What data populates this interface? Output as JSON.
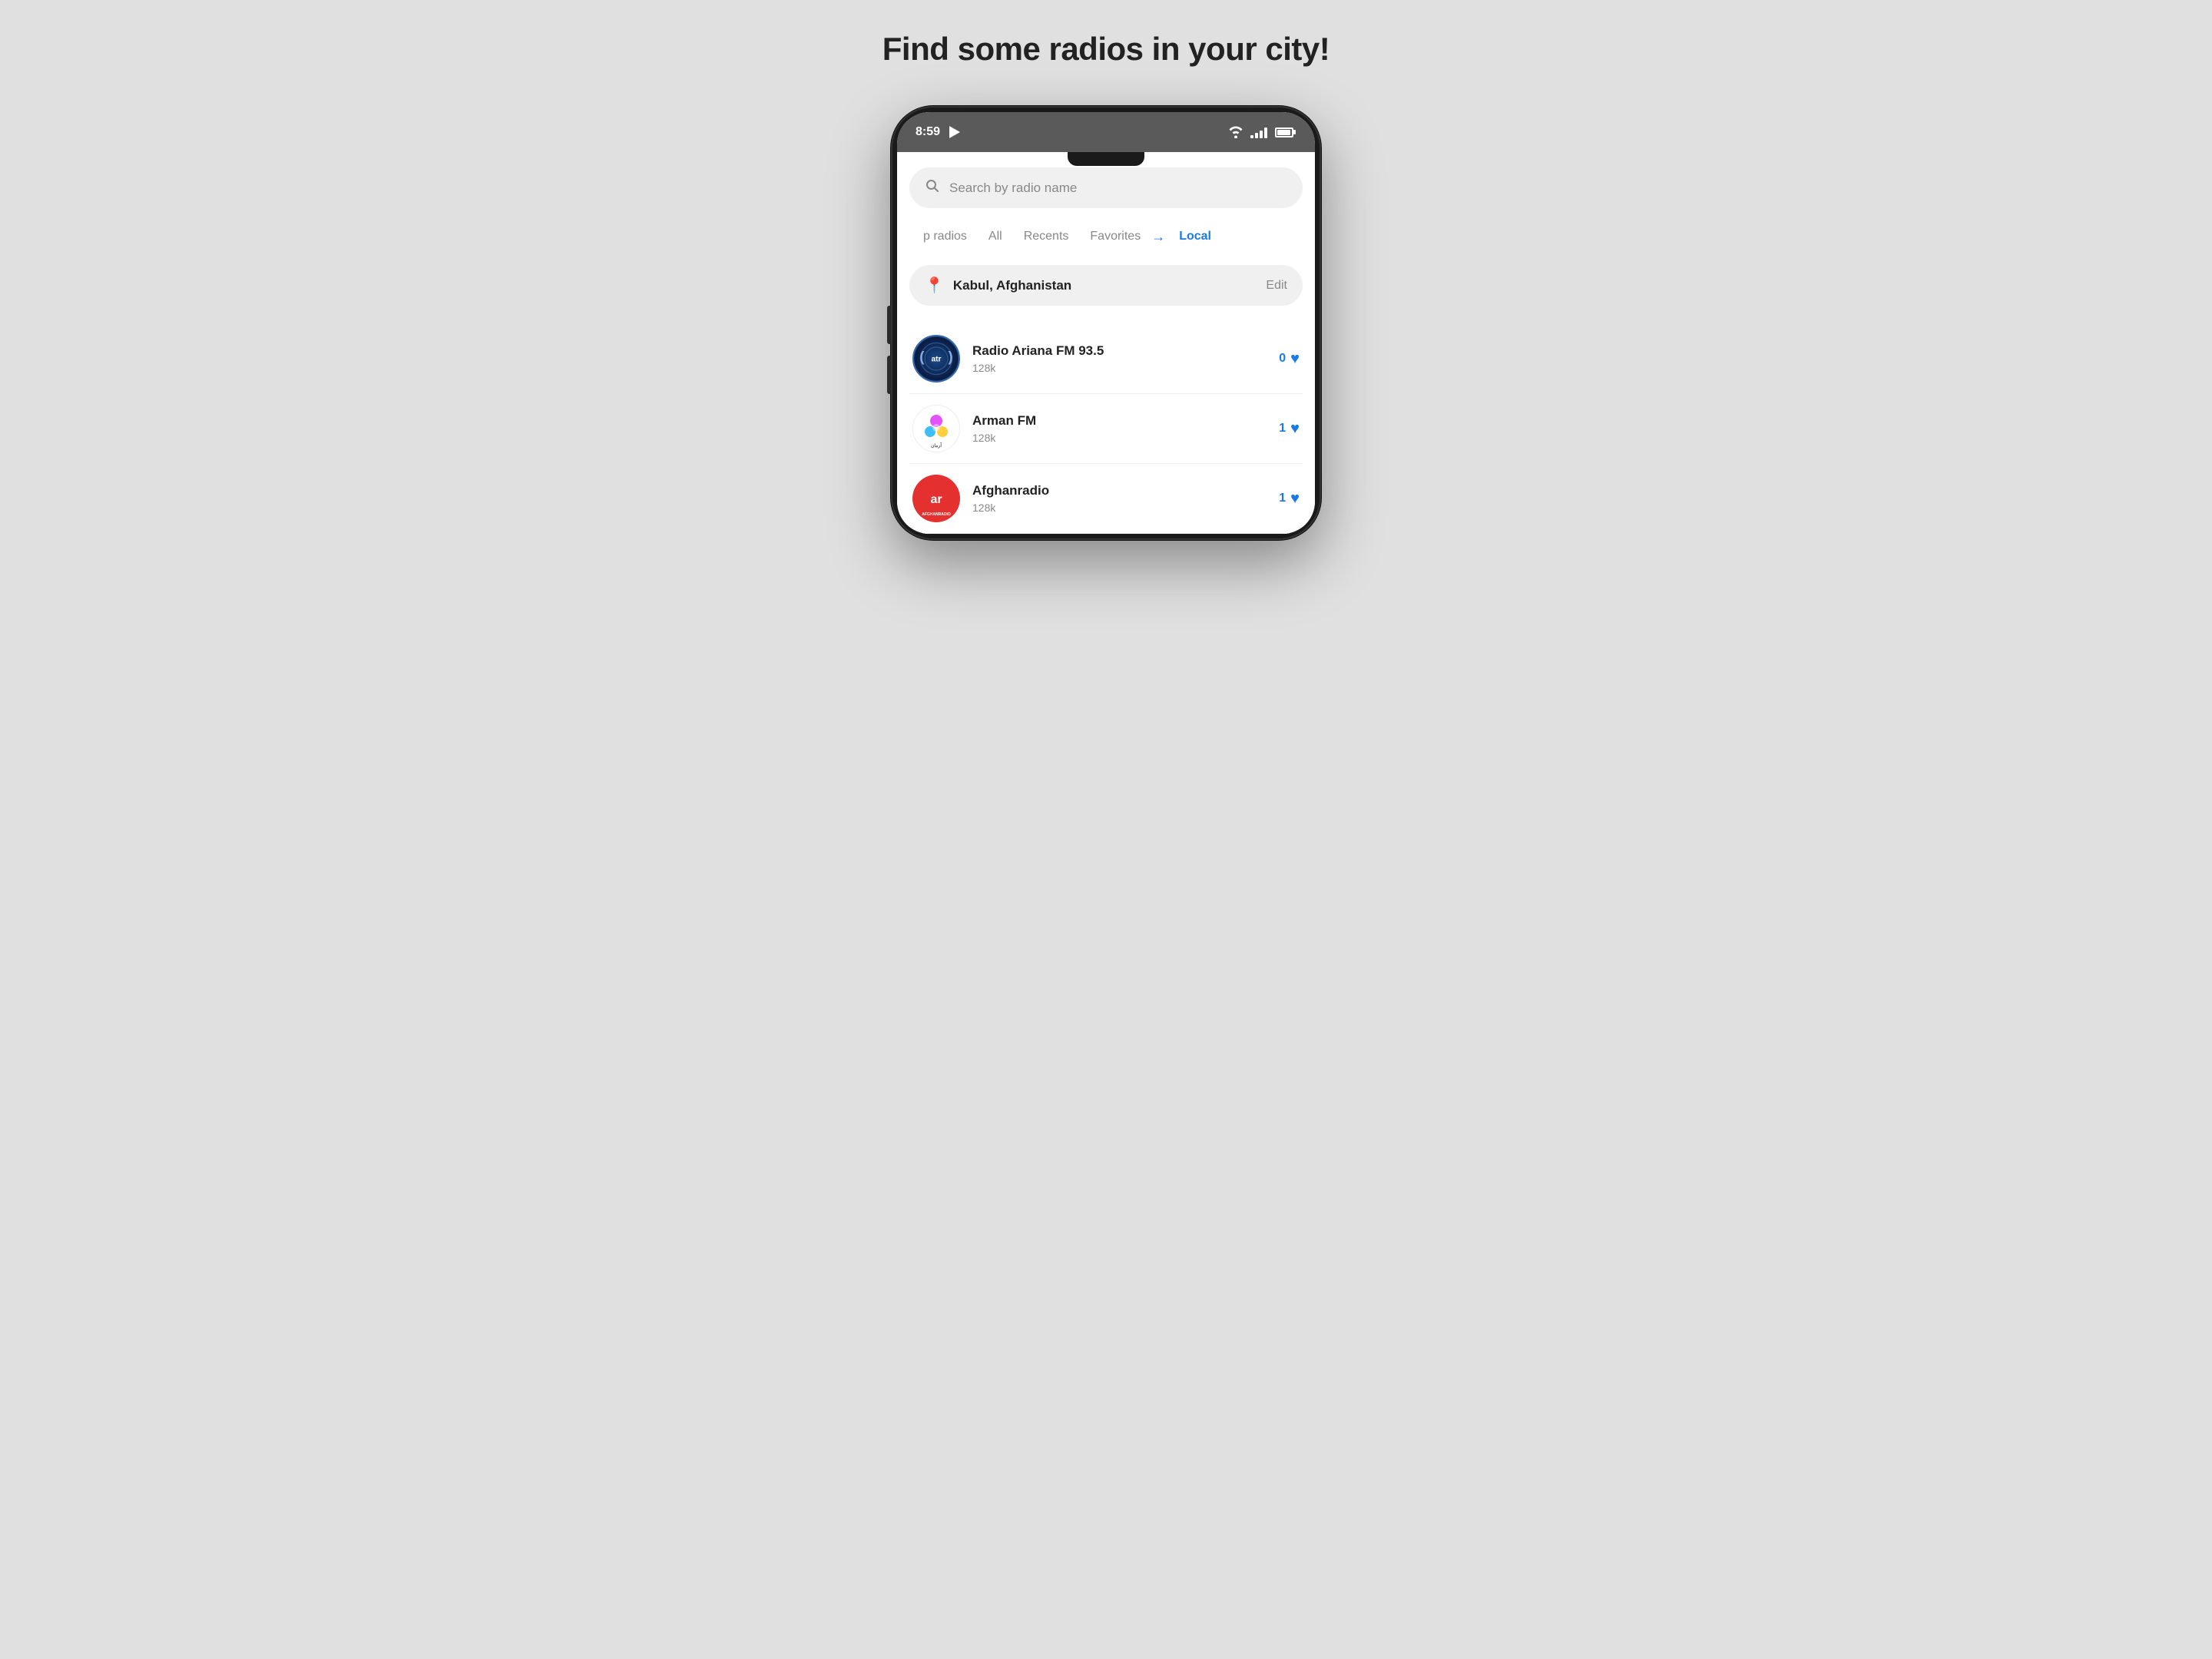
{
  "page": {
    "title": "Find some radios in your city!",
    "background": "#e0e0e0"
  },
  "status_bar": {
    "time": "8:59",
    "signal_active": true
  },
  "search": {
    "placeholder": "Search by radio name"
  },
  "tabs": [
    {
      "label": "p radios",
      "active": false
    },
    {
      "label": "All",
      "active": false
    },
    {
      "label": "Recents",
      "active": false
    },
    {
      "label": "Favorites",
      "active": false
    },
    {
      "label": "Local",
      "active": true
    }
  ],
  "location": {
    "name": "Kabul, Afghanistan",
    "edit_label": "Edit"
  },
  "radio_list": [
    {
      "name": "Radio Ariana FM 93.5",
      "bitrate": "128k",
      "favorites": "0",
      "logo_type": "atr"
    },
    {
      "name": "Arman FM",
      "bitrate": "128k",
      "favorites": "1",
      "logo_type": "arman"
    },
    {
      "name": "Afghanradio",
      "bitrate": "128k",
      "favorites": "1",
      "logo_type": "afghan"
    }
  ]
}
